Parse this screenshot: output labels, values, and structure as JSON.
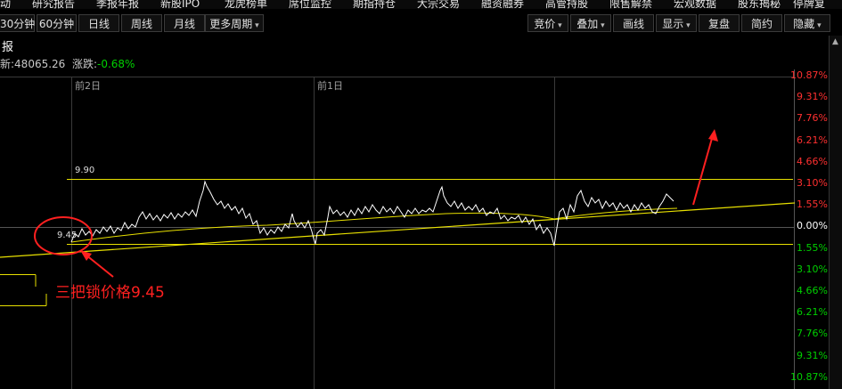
{
  "menu": [
    "动",
    "研究报告",
    "季报年报",
    "新股IPO",
    "龙虎榜单",
    "席位监控",
    "期指持仓",
    "大宗交易",
    "融资融券",
    "高管持股",
    "限售解禁",
    "宏观数据",
    "股东揭秘",
    "停牌复"
  ],
  "toolbar_left": [
    "30分钟",
    "60分钟",
    "日线",
    "周线",
    "月线",
    "更多周期"
  ],
  "toolbar_right": [
    "竞价",
    "叠加",
    "画线",
    "显示",
    "复盘",
    "简约",
    "隐藏"
  ],
  "title": "报",
  "info": {
    "latest_label": "新:",
    "latest_value": "48065.26",
    "change_label": "涨跌:",
    "change_value": "-0.68%"
  },
  "day_labels": [
    "前2日",
    "前1日"
  ],
  "axis_labels": [
    {
      "text": "10.87%",
      "color": "#ff3030"
    },
    {
      "text": "9.31%",
      "color": "#ff3030"
    },
    {
      "text": "7.76%",
      "color": "#ff3030"
    },
    {
      "text": "6.21%",
      "color": "#ff3030"
    },
    {
      "text": "4.66%",
      "color": "#ff3030"
    },
    {
      "text": "3.10%",
      "color": "#ff3030"
    },
    {
      "text": "1.55%",
      "color": "#ff3030"
    },
    {
      "text": "0.00%",
      "color": "#ffffff"
    },
    {
      "text": "1.55%",
      "color": "#00d000"
    },
    {
      "text": "3.10%",
      "color": "#00d000"
    },
    {
      "text": "4.66%",
      "color": "#00d000"
    },
    {
      "text": "6.21%",
      "color": "#00d000"
    },
    {
      "text": "7.76%",
      "color": "#00d000"
    },
    {
      "text": "9.31%",
      "color": "#00d000"
    },
    {
      "text": "10.87%",
      "color": "#00d000"
    }
  ],
  "price_labels": {
    "upper": "9.90",
    "lower": "9.45"
  },
  "annotation": "三把锁价格9.45",
  "colors": {
    "up": "#ff3030",
    "down": "#00d000",
    "price_line": "#ffffff",
    "avg_line": "#e8e000",
    "annotation": "#ff2020"
  }
}
